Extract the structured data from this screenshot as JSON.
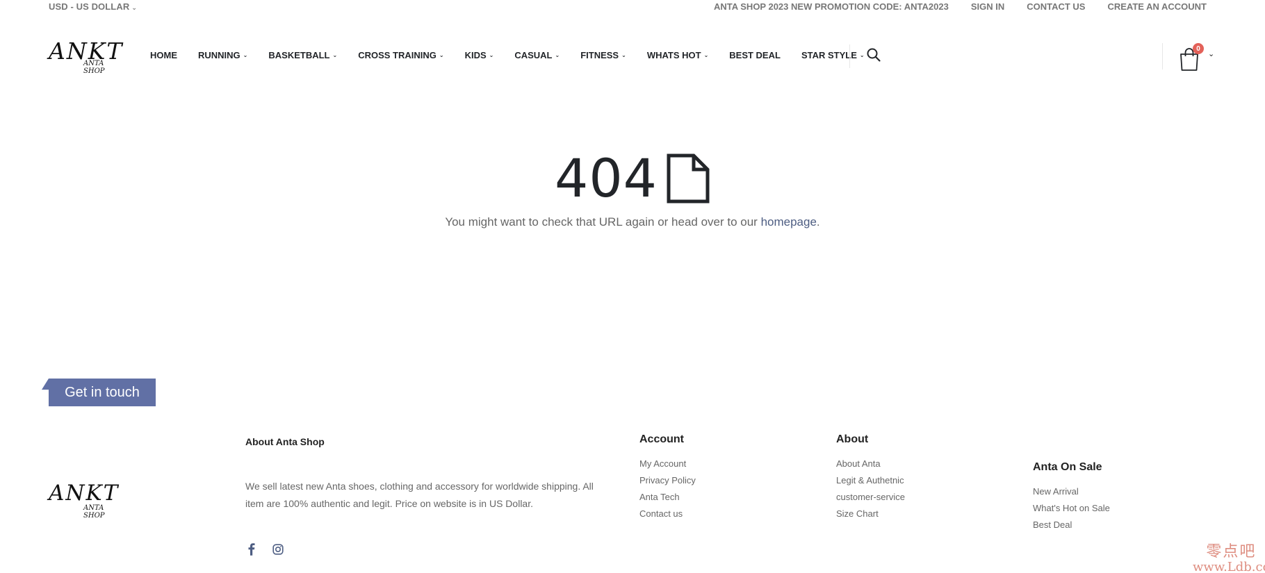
{
  "topbar": {
    "currency": "USD - US DOLLAR",
    "promo": "ANTA SHOP 2023 NEW PROMOTION CODE: ANTA2023",
    "sign_in": "SIGN IN",
    "contact": "CONTACT US",
    "create_account": "CREATE AN ACCOUNT"
  },
  "logo": {
    "main": "ANKT",
    "sub": "ANTA SHOP"
  },
  "nav": {
    "items": [
      {
        "label": "HOME",
        "dropdown": false
      },
      {
        "label": "RUNNING",
        "dropdown": true
      },
      {
        "label": "BASKETBALL",
        "dropdown": true
      },
      {
        "label": "CROSS TRAINING",
        "dropdown": true
      },
      {
        "label": "KIDS",
        "dropdown": true
      },
      {
        "label": "CASUAL",
        "dropdown": true
      },
      {
        "label": "FITNESS",
        "dropdown": true
      },
      {
        "label": "WHATS HOT",
        "dropdown": true
      },
      {
        "label": "BEST DEAL",
        "dropdown": false
      },
      {
        "label": "STAR STYLE",
        "dropdown": true
      }
    ]
  },
  "cart": {
    "count": "0"
  },
  "error": {
    "code": "404",
    "message_prefix": "You might want to check that URL again or head over to our ",
    "link": "homepage",
    "message_suffix": "."
  },
  "footer": {
    "get_in_touch": "Get in touch",
    "about_shop": {
      "title": "About Anta Shop",
      "text": "We sell latest new Anta shoes, clothing and accessory for worldwide shipping. All item are 100% authentic and legit. Price on website is in US Dollar."
    },
    "account": {
      "title": "Account",
      "links": [
        "My Account",
        "Privacy Policy",
        "Anta Tech",
        "Contact us"
      ]
    },
    "about": {
      "title": "About",
      "links": [
        "About Anta",
        "Legit & Authetnic",
        "customer-service",
        "Size Chart"
      ]
    },
    "sale": {
      "title": "Anta On Sale",
      "links": [
        "New Arrival",
        "What's Hot on Sale",
        "Best Deal"
      ]
    },
    "social": [
      "facebook-icon",
      "instagram-icon"
    ]
  },
  "watermark": {
    "cn": "零点吧",
    "site": "www.Ldb.cc"
  },
  "colors": {
    "accent": "#6170a5",
    "badge": "#e36159",
    "link": "#4d5d82"
  }
}
